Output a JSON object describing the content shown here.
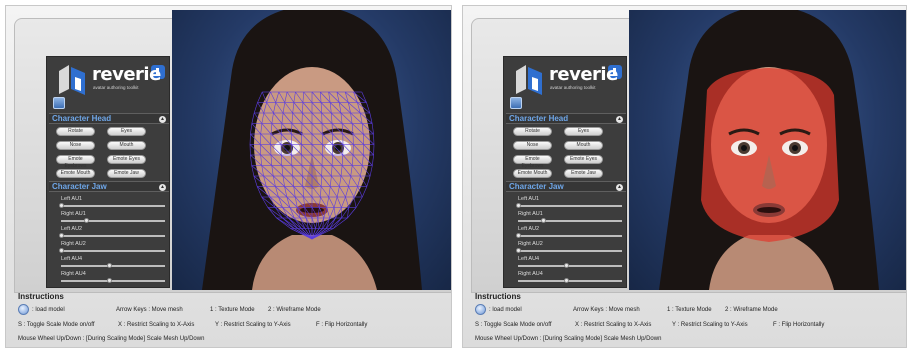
{
  "screens": [
    {
      "mode": "wireframe",
      "logo": {
        "wordmark": "reverie",
        "tagline": "avatar authoring toolkit",
        "icon": "reverie-logo-icon"
      },
      "head_section": {
        "title": "Character Head",
        "buttons": [
          "Rotate",
          "Eyes",
          "Nose",
          "Mouth",
          "Emote Eyebrows",
          "Emote Eyes",
          "Emote Mouth",
          "Emote Jaw"
        ]
      },
      "jaw_section": {
        "title": "Character Jaw",
        "sliders": [
          {
            "label": "Left AU1",
            "value": 0.0
          },
          {
            "label": "Right AU1",
            "value": 0.25
          },
          {
            "label": "Left AU2",
            "value": 0.0
          },
          {
            "label": "Right AU2",
            "value": 0.0
          },
          {
            "label": "Left AU4",
            "value": 0.48
          },
          {
            "label": "Right AU4",
            "value": 0.48
          }
        ]
      }
    },
    {
      "mode": "texture",
      "logo": {
        "wordmark": "reverie",
        "tagline": "avatar authoring toolkit",
        "icon": "reverie-logo-icon"
      },
      "head_section": {
        "title": "Character Head",
        "buttons": [
          "Rotate",
          "Eyes",
          "Nose",
          "Mouth",
          "Emote Eyebrows",
          "Emote Eyes",
          "Emote Mouth",
          "Emote Jaw"
        ]
      },
      "jaw_section": {
        "title": "Character Jaw",
        "sliders": [
          {
            "label": "Left AU1",
            "value": 0.0
          },
          {
            "label": "Right AU1",
            "value": 0.25
          },
          {
            "label": "Left AU2",
            "value": 0.0
          },
          {
            "label": "Right AU2",
            "value": 0.0
          },
          {
            "label": "Left AU4",
            "value": 0.48
          },
          {
            "label": "Right AU4",
            "value": 0.48
          }
        ]
      }
    }
  ],
  "instructions": {
    "title": "Instructions",
    "load_model": ": load model",
    "arrow_keys": "Arrow Keys : Move mesh",
    "texture_mode": "1 : Texture Mode",
    "wireframe_mode": "2 : Wireframe Mode",
    "toggle_scale": "S : Toggle Scale Mode on/off",
    "restrict_x": "X : Restrict Scaling to X-Axis",
    "restrict_y": "Y : Restrict Scaling to Y-Axis",
    "flip": "F : Flip Horizontally",
    "mouse_wheel": "Mouse Wheel Up/Down : [During Scaling Mode] Scale Mesh Up/Down"
  },
  "colors": {
    "panel_bg": "#3d3d3d",
    "section_title": "#6ea6e8",
    "wireframe": "#5a3ce0",
    "texture_overlay": "#e03a2e",
    "viewport_bg": "#243a66"
  }
}
